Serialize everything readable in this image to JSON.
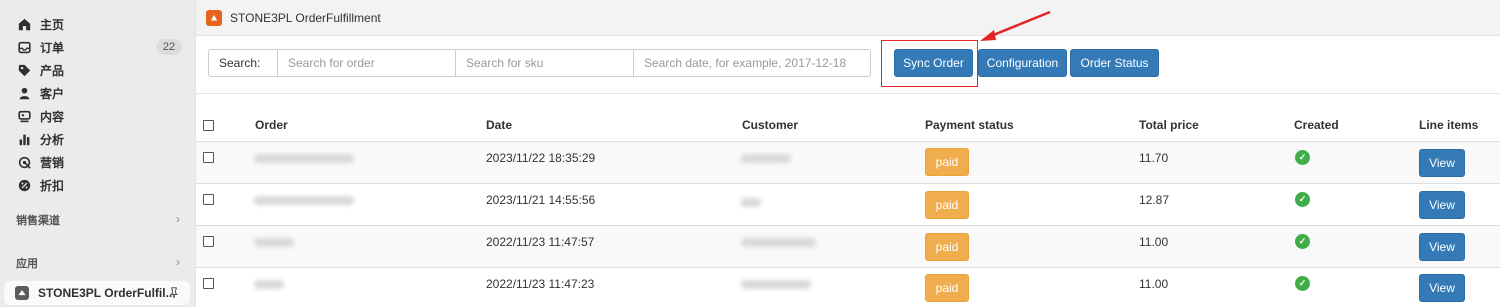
{
  "sidebar": {
    "items": [
      {
        "label": "主页",
        "icon": "home-icon"
      },
      {
        "label": "订单",
        "icon": "inbox-icon",
        "badge": "22"
      },
      {
        "label": "产品",
        "icon": "tag-icon"
      },
      {
        "label": "客户",
        "icon": "person-icon"
      },
      {
        "label": "内容",
        "icon": "content-icon"
      },
      {
        "label": "分析",
        "icon": "bar-chart-icon"
      },
      {
        "label": "营销",
        "icon": "target-icon"
      },
      {
        "label": "折扣",
        "icon": "discount-icon"
      }
    ],
    "sales_channels": {
      "label": "销售渠道"
    },
    "apps": {
      "label": "应用"
    },
    "current_app": {
      "label": "STONE3PL OrderFulfil...",
      "icon": "app-icon",
      "pin_icon": "pin-icon"
    }
  },
  "header": {
    "title": "STONE3PL OrderFulfillment",
    "logo_color": "#e8631c"
  },
  "toolbar": {
    "search_label": "Search:",
    "order_placeholder": "Search for order",
    "sku_placeholder": "Search for sku",
    "date_placeholder": "Search date, for example, 2017-12-18",
    "sync_label": "Sync Order",
    "config_label": "Configuration",
    "status_label": "Order Status"
  },
  "table": {
    "columns": [
      "Order",
      "Date",
      "Customer",
      "Payment status",
      "Total price",
      "Created",
      "Line items"
    ],
    "rows": [
      {
        "date": "2023/11/22 18:35:29",
        "payment": "paid",
        "total": "11.70",
        "view": "View"
      },
      {
        "date": "2023/11/21 14:55:56",
        "payment": "paid",
        "total": "12.87",
        "view": "View"
      },
      {
        "date": "2022/11/23 11:47:57",
        "payment": "paid",
        "total": "11.00",
        "view": "View"
      },
      {
        "date": "2022/11/23 11:47:23",
        "payment": "paid",
        "total": "11.00",
        "view": "View"
      }
    ]
  },
  "colors": {
    "primary": "#337ab7",
    "paid": "#f0ad4e",
    "created_ok": "#3fae49",
    "annotation": "#e32424"
  }
}
